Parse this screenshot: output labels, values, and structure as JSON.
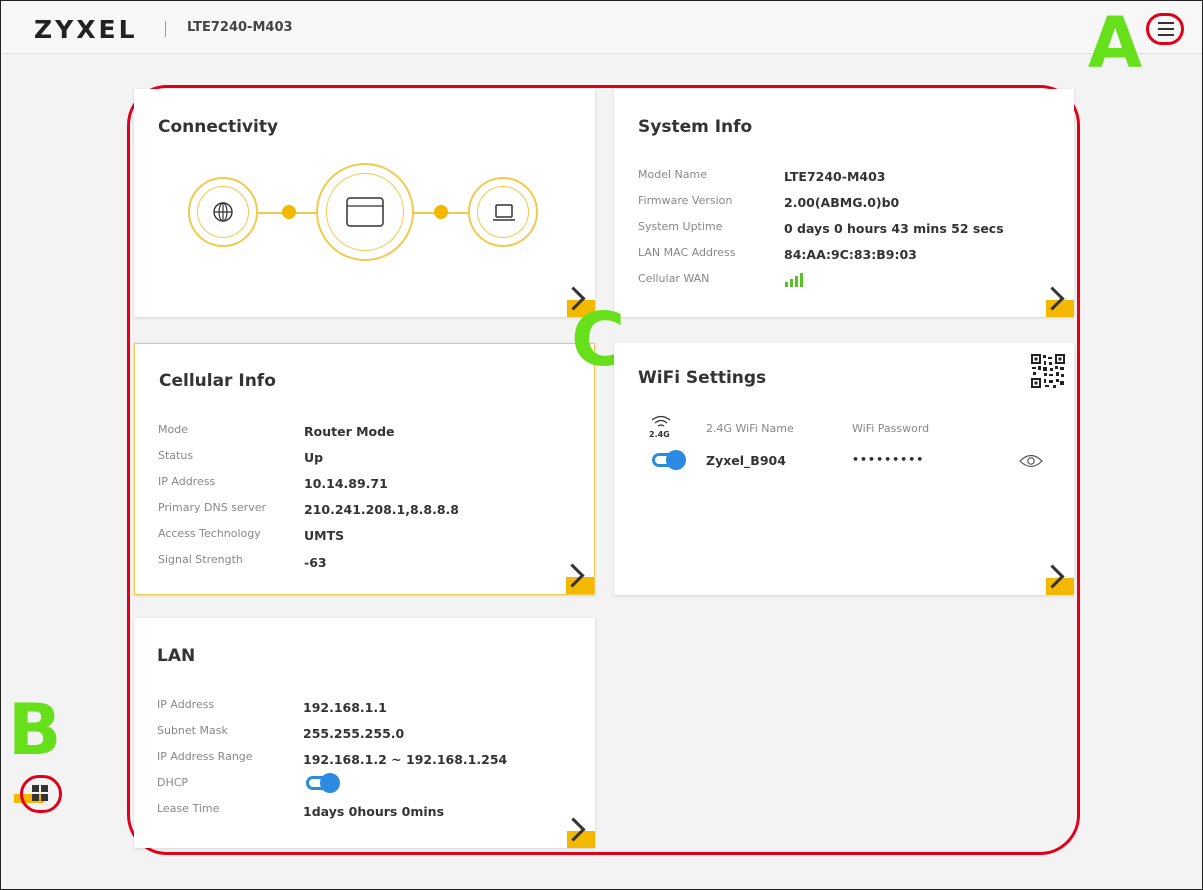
{
  "header": {
    "brand": "ZYXEL",
    "model": "LTE7240-M403"
  },
  "annotations": {
    "a": "A",
    "b": "B",
    "c": "C"
  },
  "connectivity": {
    "title": "Connectivity"
  },
  "system_info": {
    "title": "System Info",
    "rows": [
      {
        "label": "Model Name",
        "value": "LTE7240-M403"
      },
      {
        "label": "Firmware Version",
        "value": "2.00(ABMG.0)b0"
      },
      {
        "label": "System Uptime",
        "value": "0 days 0 hours 43 mins 52 secs"
      },
      {
        "label": "LAN MAC Address",
        "value": "84:AA:9C:83:B9:03"
      },
      {
        "label": "Cellular WAN",
        "value": ""
      }
    ]
  },
  "cellular_info": {
    "title": "Cellular Info",
    "rows": [
      {
        "label": "Mode",
        "value": "Router Mode"
      },
      {
        "label": "Status",
        "value": "Up"
      },
      {
        "label": "IP Address",
        "value": "10.14.89.71"
      },
      {
        "label": "Primary DNS server",
        "value": "210.241.208.1,8.8.8.8"
      },
      {
        "label": "Access Technology",
        "value": "UMTS"
      },
      {
        "label": "Signal Strength",
        "value": "-63"
      }
    ]
  },
  "wifi_settings": {
    "title": "WiFi Settings",
    "band_label": "2.4G",
    "name_header": "2.4G WiFi Name",
    "password_header": "WiFi Password",
    "ssid": "Zyxel_B904",
    "password_masked": "•••••••••"
  },
  "lan": {
    "title": "LAN",
    "rows": [
      {
        "label": "IP Address",
        "value": "192.168.1.1"
      },
      {
        "label": "Subnet Mask",
        "value": "255.255.255.0"
      },
      {
        "label": "IP Address Range",
        "value": "192.168.1.2 ~ 192.168.1.254"
      },
      {
        "label": "DHCP",
        "value": ""
      },
      {
        "label": "Lease Time",
        "value": "1days 0hours 0mins"
      }
    ]
  },
  "colors": {
    "accent": "#f5b800",
    "toggle": "#2b8be3",
    "annotation_red": "#e1001a",
    "annotation_green": "#66e01a"
  }
}
